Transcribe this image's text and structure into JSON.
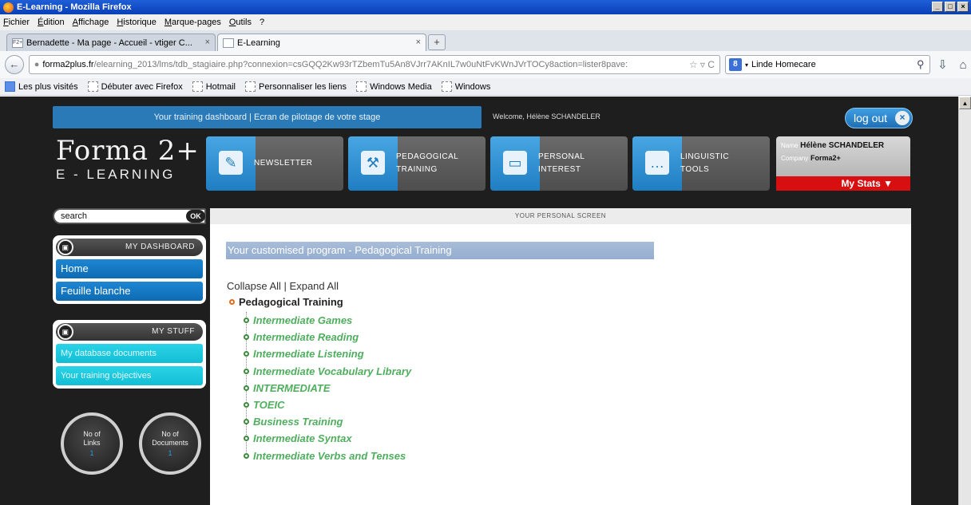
{
  "window": {
    "title": "E-Learning - Mozilla Firefox",
    "controls": [
      "_",
      "□",
      "×"
    ]
  },
  "menubar": [
    "Fichier",
    "Édition",
    "Affichage",
    "Historique",
    "Marque-pages",
    "Outils",
    "?"
  ],
  "tabs": [
    {
      "label": "Bernadette - Ma page - Accueil - vtiger C...",
      "icon": "F2+",
      "close": "×"
    },
    {
      "label": "E-Learning",
      "icon": "",
      "close": "×"
    }
  ],
  "newtab": "+",
  "url": {
    "domain": "forma2plus.fr",
    "path": "/elearning_2013/lms/tdb_stagiaire.php?connexion=csGQQ2Kw93rTZbemTu5An8VJrr7AKnIL7w0uNtFvKWnJVrTOCy8action=lister8pave:",
    "icons": "☆ ▿ C"
  },
  "search": {
    "engine": "8",
    "value": "Linde Homecare"
  },
  "bookmarks": [
    "Les plus visités",
    "Débuter avec Firefox",
    "Hotmail",
    "Personnaliser les liens",
    "Windows Media",
    "Windows"
  ],
  "site": {
    "banner": "Your training dashboard  |  Ecran de pilotage de votre stage",
    "welcome": "Welcome, Hélène SCHANDELER",
    "logout": "log out",
    "logout_x": "×",
    "logo_line1": "Forma 2+",
    "logo_line2": "E - LEARNING",
    "nav": [
      {
        "line1": "NEWSLETTER",
        "line2": "",
        "icon": "✎"
      },
      {
        "line1": "PEDAGOGICAL",
        "line2": "TRAINING",
        "icon": "⚒"
      },
      {
        "line1": "PERSONAL",
        "line2": "INTEREST",
        "icon": "▭"
      },
      {
        "line1": "LINGUISTIC",
        "line2": "TOOLS",
        "icon": "…"
      }
    ],
    "user": {
      "name_key": "Name",
      "name": "Hélène SCHANDELER",
      "company_key": "Company",
      "company": "Forma2+",
      "stats": "My Stats  ▼"
    },
    "search_value": "search",
    "ok": "OK",
    "dashboard": {
      "title": "MY DASHBOARD",
      "items": [
        "Home",
        "Feuille blanche"
      ]
    },
    "stuff": {
      "title": "MY STUFF",
      "items": [
        "My database documents",
        "Your training objectives"
      ]
    },
    "counters": [
      {
        "line1": "No of",
        "line2": "Links",
        "value": "1"
      },
      {
        "line1": "No of",
        "line2": "Documents",
        "value": "1"
      }
    ],
    "screen_label": "YOUR PERSONAL SCREEN",
    "program_title": "Your customised program - Pedagogical Training",
    "collapse": "Collapse All",
    "sep": " | ",
    "expand": "Expand All",
    "root": "Pedagogical Training",
    "children": [
      "Intermediate Games",
      "Intermediate Reading",
      "Intermediate Listening",
      "Intermediate Vocabulary Library",
      "INTERMEDIATE",
      "TOEIC",
      "Business Training",
      "Intermediate Syntax",
      "Intermediate Verbs and Tenses"
    ]
  },
  "colors": {
    "accent_blue": "#2a7ab8",
    "stats_red": "#d80f10",
    "tree_green": "#4fae5e",
    "cyan_item": "#13bdd4"
  }
}
